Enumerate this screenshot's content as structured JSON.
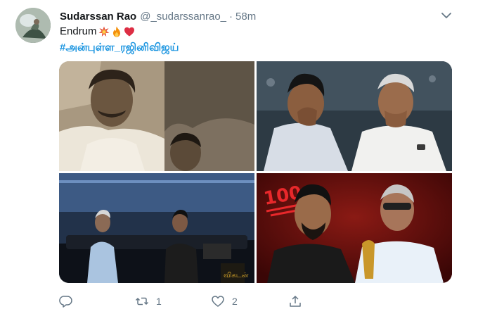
{
  "tweet": {
    "author_name": "Sudarssan Rao",
    "author_handle": "@_sudarssanrao_",
    "separator": "·",
    "time": "58m",
    "text": "Endrum",
    "hashtag": "#அன்புள்ள_ரஜினிவிஜய்"
  },
  "actions": {
    "retweet_count": "1",
    "like_count": "2"
  },
  "icons": {
    "avatar": "avatar",
    "menu": "chevron-down-icon",
    "reply": "reply-icon",
    "retweet": "retweet-icon",
    "like": "heart-icon",
    "share": "share-icon"
  },
  "colors": {
    "link": "#1b95e0",
    "secondary": "#657786",
    "primary_text": "#14171a"
  }
}
